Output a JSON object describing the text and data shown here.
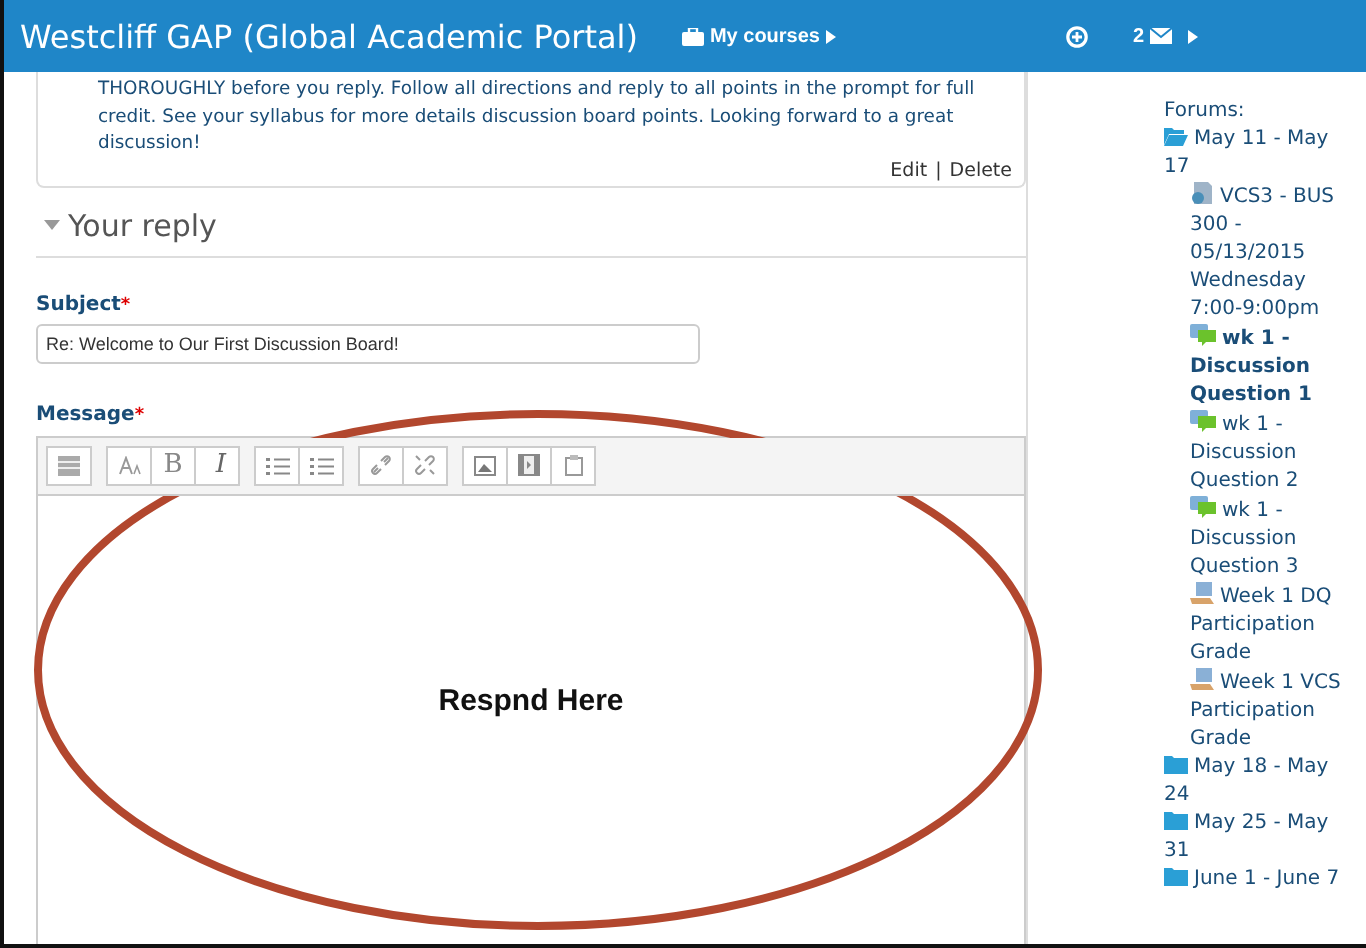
{
  "header": {
    "title": "Westcliff GAP (Global Academic Portal)",
    "courses_menu": "My courses",
    "message_count": "2"
  },
  "post": {
    "text": "THOROUGHLY before you reply. Follow all directions and reply to all points in the prompt for full credit. See your syllabus for more details discussion board points. Looking forward to a great discussion!",
    "links": [
      "Edit",
      "Delete"
    ],
    "separator": "|"
  },
  "reply": {
    "heading": "Your reply",
    "expanded": true,
    "subject": {
      "label": "Subject",
      "required_mark": "*",
      "value": "Re: Welcome to Our First Discussion Board!"
    },
    "message": {
      "label": "Message",
      "required_mark": "*",
      "toolbar": [
        [
          {
            "kind": "toggle"
          }
        ],
        [
          {
            "kind": "font"
          },
          {
            "kind": "bold",
            "label": "B"
          },
          {
            "kind": "italic",
            "label": "I"
          }
        ],
        [
          {
            "kind": "bullets"
          },
          {
            "kind": "numbers"
          }
        ],
        [
          {
            "kind": "link"
          },
          {
            "kind": "unlink"
          }
        ],
        [
          {
            "kind": "image"
          },
          {
            "kind": "media"
          },
          {
            "kind": "paste"
          }
        ]
      ],
      "annotation": "Respnd Here"
    }
  },
  "sidebar": {
    "items": [
      {
        "kind": "text",
        "label": "Forums:"
      },
      {
        "kind": "folder",
        "label": "May 11 - May 17",
        "expanded": true,
        "children": [
          {
            "kind": "page",
            "label": "VCS3 - BUS 300 - 05/13/2015 Wednesday 7:00-9:00pm",
            "selected": false
          },
          {
            "kind": "forum",
            "label": "wk 1 - Discussion Question 1",
            "selected": true
          },
          {
            "kind": "forum",
            "label": "wk 1 - Discussion Question 2",
            "selected": false
          },
          {
            "kind": "forum",
            "label": "wk 1 - Discussion Question 3",
            "selected": false
          },
          {
            "kind": "grade",
            "label": "Week 1 DQ Participation Grade",
            "selected": false
          },
          {
            "kind": "grade",
            "label": "Week 1 VCS Participation Grade",
            "selected": false
          }
        ]
      },
      {
        "kind": "folder",
        "label": "May 18 - May 24",
        "expanded": false
      },
      {
        "kind": "folder",
        "label": "May 25 - May 31",
        "expanded": false
      },
      {
        "kind": "folder",
        "label": "June 1 - June 7",
        "expanded": false
      }
    ]
  }
}
